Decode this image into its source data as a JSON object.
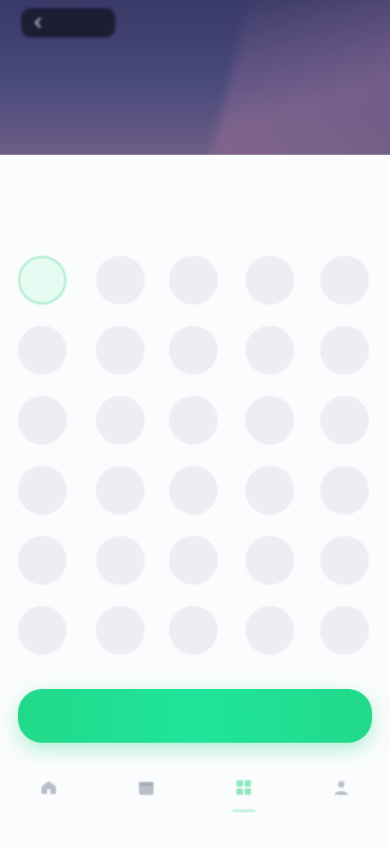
{
  "header": {
    "back_label": "",
    "right_text": "",
    "title": "",
    "subtitle": ""
  },
  "content": {
    "left_label": "",
    "right_label": "",
    "sub_label": ""
  },
  "grid": {
    "cells": [
      {
        "label": "",
        "selected": true
      },
      {
        "label": "",
        "selected": false
      },
      {
        "label": "",
        "selected": false
      },
      {
        "label": "",
        "selected": false
      },
      {
        "label": "",
        "selected": false
      },
      {
        "label": "",
        "selected": false
      },
      {
        "label": "",
        "selected": false
      },
      {
        "label": "",
        "selected": false
      },
      {
        "label": "",
        "selected": false
      },
      {
        "label": "",
        "selected": false
      },
      {
        "label": "",
        "selected": false
      },
      {
        "label": "",
        "selected": false
      },
      {
        "label": "",
        "selected": false
      },
      {
        "label": "",
        "selected": false
      },
      {
        "label": "",
        "selected": false
      },
      {
        "label": "",
        "selected": false
      },
      {
        "label": "",
        "selected": false
      },
      {
        "label": "",
        "selected": false
      },
      {
        "label": "",
        "selected": false
      },
      {
        "label": "",
        "selected": false
      },
      {
        "label": "",
        "selected": false
      },
      {
        "label": "",
        "selected": false
      },
      {
        "label": "",
        "selected": false
      },
      {
        "label": "",
        "selected": false
      },
      {
        "label": "",
        "selected": false
      },
      {
        "label": "",
        "selected": false
      },
      {
        "label": "",
        "selected": false
      },
      {
        "label": "",
        "selected": false
      },
      {
        "label": "",
        "selected": false
      },
      {
        "label": "",
        "selected": false
      }
    ]
  },
  "cta": {
    "label": ""
  },
  "bottom_nav": {
    "items": [
      {
        "label": "",
        "icon": "home-icon",
        "active": false
      },
      {
        "label": "",
        "icon": "calendar-icon",
        "active": false
      },
      {
        "label": "",
        "icon": "grid-icon",
        "active": true
      },
      {
        "label": "",
        "icon": "profile-icon",
        "active": false
      }
    ]
  },
  "colors": {
    "accent": "#22d98a",
    "hero_bg": "#3a3a68",
    "cell_bg": "#eceef3",
    "selected_border": "#b6f0d3"
  }
}
